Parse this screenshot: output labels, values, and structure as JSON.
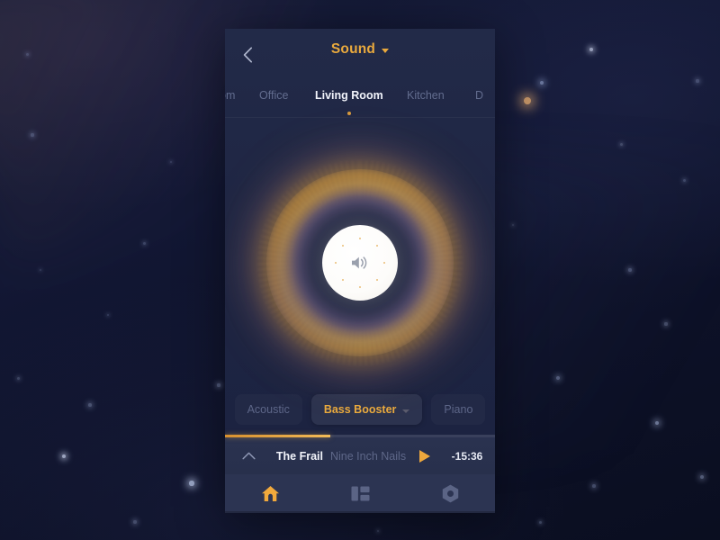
{
  "app": {
    "header": {
      "back_icon": "chevron-left-icon",
      "title": "Sound",
      "title_caret_icon": "caret-down-icon",
      "accent_color": "#e9a93d"
    },
    "rooms": {
      "tabs": [
        {
          "label": "om",
          "active": false,
          "clipped": true
        },
        {
          "label": "Office",
          "active": false,
          "clipped": false
        },
        {
          "label": "Living Room",
          "active": true,
          "clipped": false
        },
        {
          "label": "Kitchen",
          "active": false,
          "clipped": false
        },
        {
          "label": "D",
          "active": false,
          "clipped": true
        }
      ],
      "active_indicator": "dot"
    },
    "visualizer": {
      "speaker_icon": "speaker-volume-icon",
      "glow_gold": "#f0ac34",
      "glow_violet": "#a88cd6",
      "level_dot_count": 8
    },
    "equalizer": {
      "presets": [
        {
          "label": "Acoustic",
          "selected": false
        },
        {
          "label": "Bass Booster",
          "selected": true
        },
        {
          "label": "Piano",
          "selected": false
        }
      ],
      "dropdown_icon": "chevron-down-icon"
    },
    "player": {
      "expand_icon": "chevron-up-icon",
      "track_title": "The Frail",
      "track_artist": "Nine Inch Nails",
      "play_icon": "play-icon",
      "time_remaining": "-15:36",
      "progress_percent": 39
    },
    "bottom_nav": {
      "items": [
        {
          "icon": "home-icon",
          "active": true
        },
        {
          "icon": "dashboard-icon",
          "active": false
        },
        {
          "icon": "settings-nut-icon",
          "active": false
        }
      ]
    }
  }
}
